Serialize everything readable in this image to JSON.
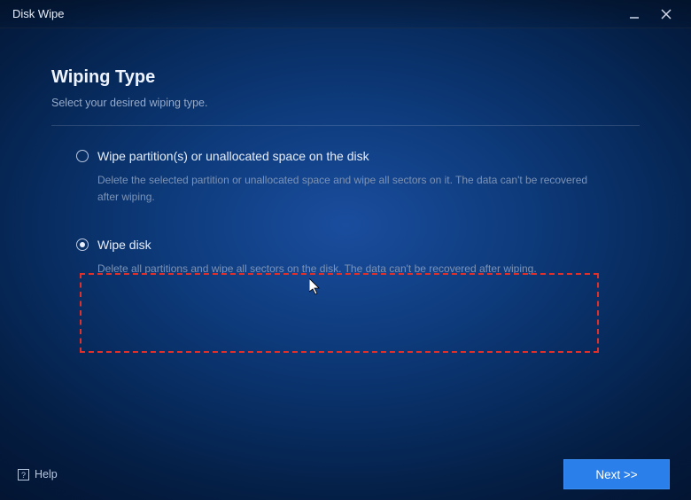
{
  "window": {
    "title": "Disk Wipe"
  },
  "page": {
    "heading": "Wiping Type",
    "subheading": "Select your desired wiping type."
  },
  "options": [
    {
      "label": "Wipe partition(s) or unallocated space on the disk",
      "description": "Delete the selected partition or unallocated space and wipe all sectors on it. The data can't be recovered after wiping.",
      "selected": false
    },
    {
      "label": "Wipe disk",
      "description": "Delete all partitions and wipe all sectors on the disk. The data can't be recovered after wiping.",
      "selected": true
    }
  ],
  "footer": {
    "help_label": "Help",
    "next_label": "Next >>"
  }
}
